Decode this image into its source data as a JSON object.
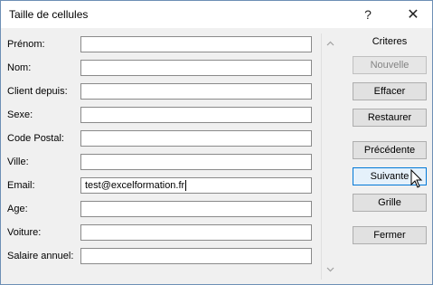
{
  "window": {
    "title": "Taille de cellules",
    "help_glyph": "?",
    "close_glyph": "✕"
  },
  "fields": [
    {
      "label": "Prénom:",
      "value": ""
    },
    {
      "label": "Nom:",
      "value": ""
    },
    {
      "label": "Client depuis:",
      "value": ""
    },
    {
      "label": "Sexe:",
      "value": ""
    },
    {
      "label": "Code Postal:",
      "value": ""
    },
    {
      "label": "Ville:",
      "value": ""
    },
    {
      "label": "Email:",
      "value": "test@excelformation.fr"
    },
    {
      "label": "Age:",
      "value": ""
    },
    {
      "label": "Voiture:",
      "value": ""
    },
    {
      "label": "Salaire annuel:",
      "value": ""
    }
  ],
  "side": {
    "heading": "Criteres",
    "buttons": {
      "nouvelle": "Nouvelle",
      "effacer": "Effacer",
      "restaurer": "Restaurer",
      "precedente": "Précédente",
      "suivante": "Suivante",
      "grille": "Grille",
      "fermer": "Fermer"
    }
  },
  "icons": {
    "scroll_up": "chevron-up-icon",
    "scroll_down": "chevron-down-icon",
    "cursor": "mouse-pointer-icon"
  },
  "colors": {
    "focus_border": "#0078d7",
    "window_border": "#6d8fb5"
  }
}
